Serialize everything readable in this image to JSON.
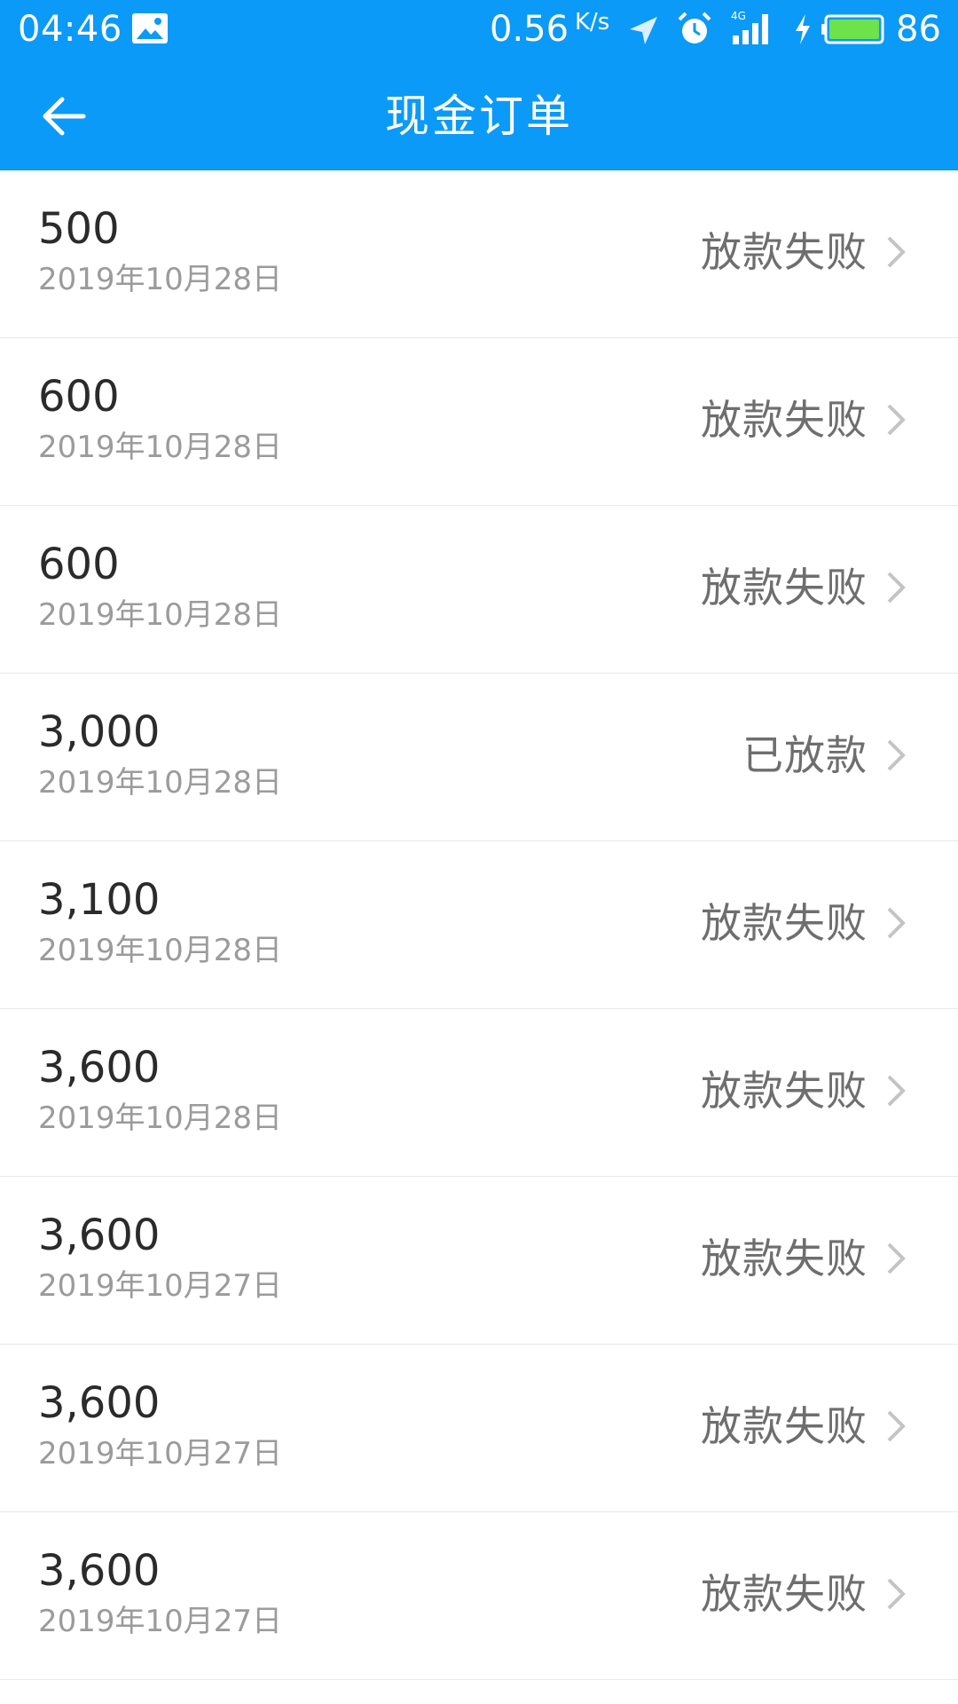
{
  "status_bar": {
    "time": "04:46",
    "network_speed": "0.56",
    "network_speed_unit": "K/s",
    "network_type": "4G",
    "battery_level": "86",
    "icons": [
      "gallery-icon",
      "location-arrow-icon",
      "alarm-icon",
      "signal-4g-icon",
      "charging-bolt-icon",
      "battery-icon"
    ],
    "accent_color": "#0b9af7"
  },
  "header": {
    "title": "现金订单",
    "back_icon": "arrow-left-icon"
  },
  "orders": [
    {
      "amount": "500",
      "date": "2019年10月28日",
      "status": "放款失败"
    },
    {
      "amount": "600",
      "date": "2019年10月28日",
      "status": "放款失败"
    },
    {
      "amount": "600",
      "date": "2019年10月28日",
      "status": "放款失败"
    },
    {
      "amount": "3,000",
      "date": "2019年10月28日",
      "status": "已放款"
    },
    {
      "amount": "3,100",
      "date": "2019年10月28日",
      "status": "放款失败"
    },
    {
      "amount": "3,600",
      "date": "2019年10月28日",
      "status": "放款失败"
    },
    {
      "amount": "3,600",
      "date": "2019年10月27日",
      "status": "放款失败"
    },
    {
      "amount": "3,600",
      "date": "2019年10月27日",
      "status": "放款失败"
    },
    {
      "amount": "3,600",
      "date": "2019年10月27日",
      "status": "放款失败"
    }
  ]
}
